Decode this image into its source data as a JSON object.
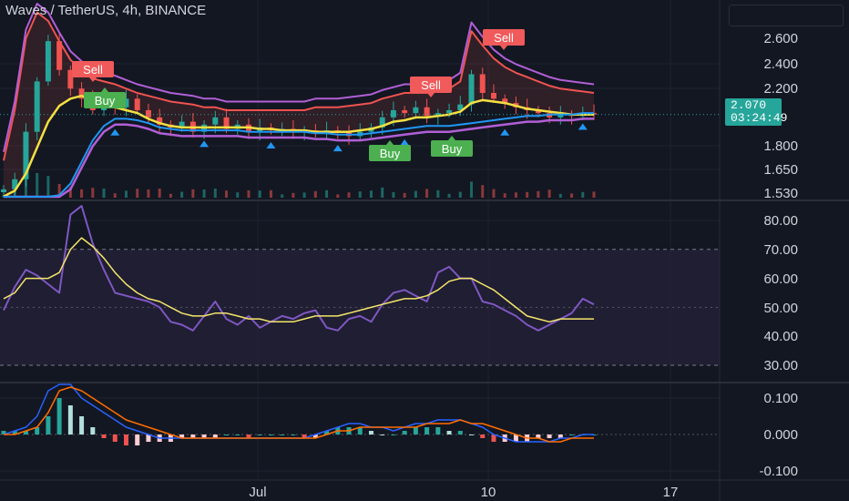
{
  "header": {
    "title": "Waves / TetherUS, 4h, BINANCE"
  },
  "last_price": {
    "price": "2.070",
    "countdown": "03:24:49"
  },
  "colors": {
    "background": "#131722",
    "grid": "#1f2230",
    "text": "#d1d4dc",
    "up": "#26a69a",
    "down": "#ef5350",
    "sell_label": "#f05a5a",
    "buy_label": "#4caf50",
    "rsi_line": "#7e57c2",
    "rsi_ma": "#f5e56b",
    "rsi_band": "#2a2440",
    "macd_line": "#2962ff",
    "signal_line": "#ff6d00",
    "fast_ma": "#f5e042",
    "keltner_upper": "#ef5350",
    "bollinger": "#b15fd6",
    "trend_blue": "#2196f3"
  },
  "chart_data": [
    {
      "type": "candlestick",
      "title": "Waves / TetherUS, 4h, BINANCE",
      "y_ticks": [
        "2.600",
        "2.400",
        "2.200",
        "1.800",
        "1.650",
        "1.530"
      ],
      "x_ticks": [
        "Jul",
        "10",
        "17"
      ],
      "last_value": 2.07,
      "signals": [
        {
          "label": "Sell",
          "x_index": 0
        },
        {
          "label": "Buy",
          "x_index": 1
        },
        {
          "label": "Sell",
          "x_index": 2
        },
        {
          "label": "Sell",
          "x_index": 3
        },
        {
          "label": "Buy",
          "x_index": 4
        },
        {
          "label": "Buy",
          "x_index": 5
        }
      ],
      "series": [
        {
          "name": "close",
          "values": [
            1.55,
            1.62,
            1.95,
            2.3,
            2.58,
            2.38,
            2.25,
            2.18,
            2.1,
            2.15,
            2.12,
            2.18,
            2.1,
            2.05,
            2.0,
            1.98,
            2.02,
            1.95,
            2.0,
            2.05,
            1.97,
            2.0,
            1.95,
            1.98,
            1.96,
            1.97,
            1.95,
            1.96,
            1.94,
            1.96,
            1.95,
            1.92,
            1.95,
            1.98,
            2.05,
            2.1,
            2.08,
            2.12,
            2.06,
            2.08,
            2.1,
            2.14,
            2.35,
            2.22,
            2.18,
            2.15,
            2.12,
            2.1,
            2.08,
            2.05,
            2.07,
            2.06,
            2.08,
            2.07
          ]
        },
        {
          "name": "upper band",
          "values": [
            1.75,
            2.1,
            2.6,
            2.78,
            2.72,
            2.58,
            2.45,
            2.38,
            2.32,
            2.3,
            2.28,
            2.25,
            2.22,
            2.2,
            2.18,
            2.16,
            2.15,
            2.14,
            2.12,
            2.12,
            2.1,
            2.1,
            2.1,
            2.1,
            2.1,
            2.1,
            2.1,
            2.1,
            2.12,
            2.12,
            2.12,
            2.13,
            2.14,
            2.15,
            2.18,
            2.2,
            2.22,
            2.22,
            2.22,
            2.23,
            2.25,
            2.3,
            2.65,
            2.55,
            2.46,
            2.4,
            2.36,
            2.33,
            2.3,
            2.27,
            2.25,
            2.24,
            2.23,
            2.22
          ]
        },
        {
          "name": "fast MA",
          "values": [
            1.5,
            1.54,
            1.66,
            1.84,
            2.02,
            2.13,
            2.18,
            2.2,
            2.17,
            2.14,
            2.12,
            2.1,
            2.08,
            2.04,
            2.01,
            1.99,
            1.98,
            1.98,
            1.98,
            1.98,
            1.98,
            1.98,
            1.98,
            1.97,
            1.97,
            1.96,
            1.96,
            1.96,
            1.95,
            1.95,
            1.95,
            1.95,
            1.96,
            1.97,
            1.99,
            2.02,
            2.03,
            2.05,
            2.05,
            2.06,
            2.07,
            2.09,
            2.15,
            2.17,
            2.16,
            2.15,
            2.13,
            2.11,
            2.1,
            2.09,
            2.08,
            2.07,
            2.07,
            2.07
          ]
        },
        {
          "name": "lower band",
          "values": [
            1.45,
            1.45,
            1.45,
            1.45,
            1.45,
            1.47,
            1.55,
            1.7,
            1.85,
            1.95,
            2.0,
            2.0,
            1.99,
            1.97,
            1.94,
            1.93,
            1.92,
            1.92,
            1.92,
            1.92,
            1.92,
            1.92,
            1.91,
            1.91,
            1.91,
            1.91,
            1.91,
            1.91,
            1.9,
            1.9,
            1.89,
            1.89,
            1.89,
            1.9,
            1.91,
            1.92,
            1.93,
            1.94,
            1.95,
            1.95,
            1.95,
            1.96,
            1.97,
            1.98,
            1.99,
            2.0,
            2.01,
            2.02,
            2.02,
            2.03,
            2.03,
            2.03,
            2.04,
            2.04
          ]
        }
      ]
    },
    {
      "type": "line",
      "title": "RSI",
      "y_ticks": [
        "80.00",
        "70.00",
        "60.00",
        "50.00",
        "40.00",
        "30.00"
      ],
      "ylim": [
        25,
        90
      ],
      "band": [
        30,
        70
      ],
      "last_value": 51,
      "series": [
        {
          "name": "RSI",
          "values": [
            49,
            57,
            63,
            61,
            58,
            55,
            82,
            85,
            72,
            63,
            55,
            54,
            53,
            52,
            50,
            45,
            44,
            42,
            47,
            52,
            46,
            44,
            47,
            43,
            45,
            47,
            46,
            48,
            49,
            43,
            42,
            46,
            47,
            45,
            51,
            55,
            56,
            54,
            52,
            62,
            64,
            60,
            60,
            52,
            51,
            49,
            47,
            44,
            42,
            44,
            46,
            48,
            53,
            51
          ]
        },
        {
          "name": "RSI MA",
          "values": [
            53,
            55,
            60,
            60,
            60,
            62,
            70,
            74,
            71,
            67,
            62,
            58,
            55,
            53,
            52,
            50,
            48,
            47,
            47,
            48,
            48,
            47,
            46,
            46,
            45,
            45,
            45,
            46,
            47,
            47,
            47,
            48,
            49,
            50,
            51,
            52,
            53,
            53,
            54,
            56,
            59,
            60,
            60,
            58,
            56,
            53,
            50,
            47,
            46,
            45,
            46,
            46,
            46,
            46
          ]
        }
      ]
    },
    {
      "type": "bar",
      "title": "MACD",
      "y_ticks": [
        "0.100",
        "0.000",
        "-0.100"
      ],
      "ylim": [
        -0.15,
        0.17
      ],
      "series": [
        {
          "name": "histogram",
          "values": [
            0.01,
            0.01,
            0.01,
            0.02,
            0.05,
            0.1,
            0.08,
            0.05,
            0.02,
            -0.01,
            -0.02,
            -0.03,
            -0.03,
            -0.02,
            -0.02,
            -0.02,
            -0.01,
            -0.01,
            -0.01,
            -0.01,
            0.0,
            0.0,
            -0.01,
            0.0,
            0.0,
            0.0,
            0.0,
            -0.01,
            -0.01,
            0.01,
            0.02,
            0.02,
            0.02,
            0.01,
            0.0,
            0.0,
            0.01,
            0.02,
            0.02,
            0.02,
            0.01,
            0.01,
            0.0,
            -0.01,
            -0.02,
            -0.02,
            -0.02,
            -0.02,
            -0.01,
            -0.01,
            -0.01,
            0.0,
            0.0,
            0.0
          ]
        },
        {
          "name": "MACD",
          "values": [
            0.0,
            0.01,
            0.02,
            0.05,
            0.12,
            0.2,
            0.15,
            0.1,
            0.08,
            0.06,
            0.04,
            0.02,
            0.01,
            0.0,
            -0.01,
            -0.01,
            -0.01,
            -0.01,
            -0.01,
            -0.01,
            -0.01,
            -0.01,
            -0.01,
            -0.01,
            -0.01,
            -0.01,
            -0.01,
            -0.01,
            0.0,
            0.01,
            0.02,
            0.03,
            0.03,
            0.02,
            0.02,
            0.01,
            0.02,
            0.03,
            0.03,
            0.04,
            0.04,
            0.04,
            0.03,
            0.02,
            0.0,
            -0.01,
            -0.02,
            -0.02,
            -0.02,
            -0.02,
            -0.01,
            -0.01,
            0.0,
            0.0
          ]
        },
        {
          "name": "Signal",
          "values": [
            0.0,
            0.0,
            0.01,
            0.02,
            0.06,
            0.12,
            0.13,
            0.12,
            0.1,
            0.08,
            0.06,
            0.04,
            0.03,
            0.02,
            0.01,
            0.0,
            -0.01,
            -0.01,
            -0.01,
            -0.01,
            -0.01,
            -0.01,
            -0.01,
            -0.01,
            -0.01,
            -0.01,
            -0.01,
            -0.01,
            -0.01,
            0.0,
            0.01,
            0.01,
            0.02,
            0.02,
            0.02,
            0.02,
            0.02,
            0.02,
            0.03,
            0.03,
            0.03,
            0.04,
            0.03,
            0.03,
            0.02,
            0.01,
            0.0,
            -0.01,
            -0.01,
            -0.02,
            -0.02,
            -0.01,
            -0.01,
            -0.01
          ]
        }
      ]
    }
  ]
}
